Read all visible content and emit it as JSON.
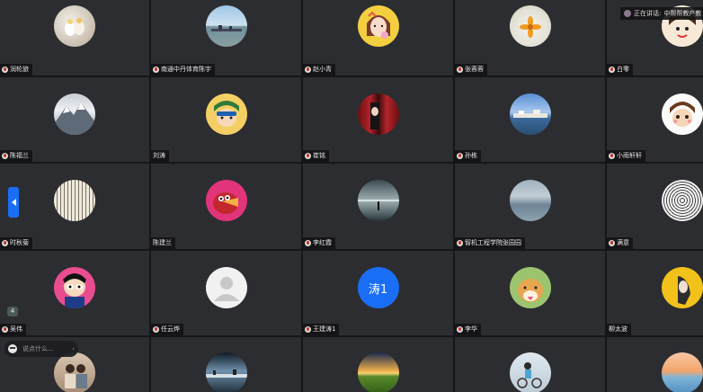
{
  "participants": [
    {
      "name": "润轮旅",
      "avatar": "avatar-birds"
    },
    {
      "name": "南通中丹体育陈宇",
      "avatar": "avatar-seaside"
    },
    {
      "name": "赵小青",
      "avatar": "avatar-cartoon-girl"
    },
    {
      "name": "张蓉蓉",
      "avatar": "avatar-flower"
    },
    {
      "name": "白零",
      "avatar": "avatar-cartoon-face"
    },
    {
      "name": "陈福兰",
      "avatar": "avatar-mountain"
    },
    {
      "name": "刘涛",
      "avatar": "avatar-cartoon-boy"
    },
    {
      "name": "崔铭",
      "avatar": "avatar-portrait"
    },
    {
      "name": "孙栋",
      "avatar": "avatar-lake-city"
    },
    {
      "name": "小雨轩轩",
      "avatar": "avatar-cartoon-kid"
    },
    {
      "name": "时秋菊",
      "avatar": "avatar-calligraphy"
    },
    {
      "name": "陈建兰",
      "avatar": "avatar-red-bird"
    },
    {
      "name": "李红霞",
      "avatar": "avatar-ocean"
    },
    {
      "name": "智机工程学院张园园",
      "avatar": "avatar-grey-water"
    },
    {
      "name": "满意",
      "avatar": "avatar-sketch"
    },
    {
      "name": "吴伟",
      "avatar": "avatar-cartoon-sailor"
    },
    {
      "name": "任云烨",
      "avatar": "avatar-default"
    },
    {
      "name": "王建涛1",
      "avatar": "avatar-text",
      "initials": "涛1"
    },
    {
      "name": "李华",
      "avatar": "avatar-dog"
    },
    {
      "name": "柳太波",
      "avatar": "avatar-yellow-figure"
    },
    {
      "name": "",
      "avatar": "avatar-people"
    },
    {
      "name": "",
      "avatar": "avatar-shoreline"
    },
    {
      "name": "",
      "avatar": "avatar-sunset-field"
    },
    {
      "name": "",
      "avatar": "avatar-bike-rider"
    },
    {
      "name": "",
      "avatar": "avatar-peach-sky"
    }
  ],
  "speaking": {
    "label": "正在讲话:",
    "speaker": "中帮帮教产教"
  },
  "count_badge": "4",
  "chat": {
    "placeholder": "说点什么...",
    "caret": "‹"
  },
  "colors": {
    "accent": "#1a6ef5",
    "tile": "#2c2d31",
    "background": "#15161a"
  }
}
